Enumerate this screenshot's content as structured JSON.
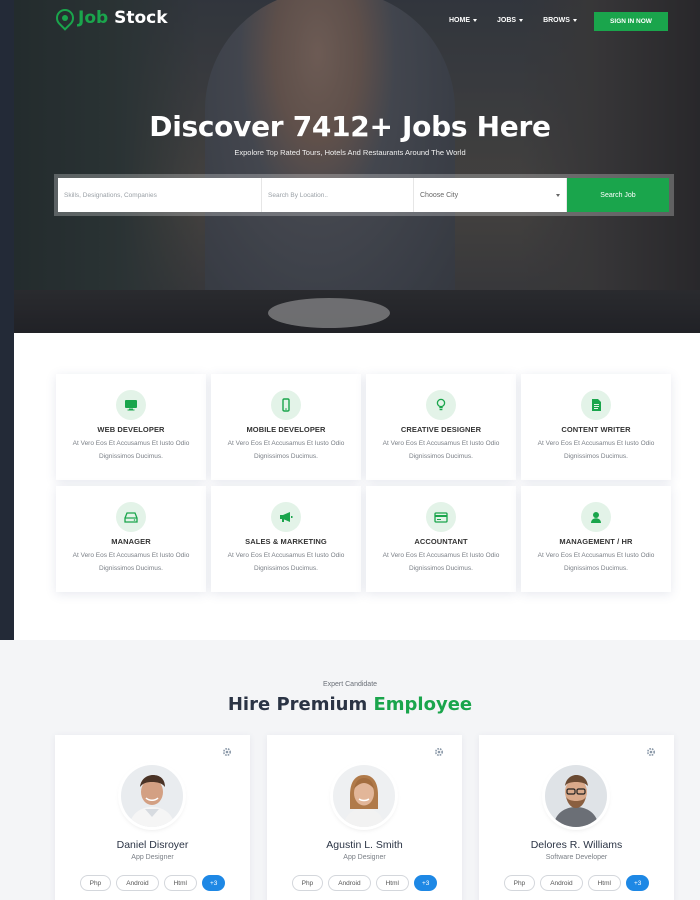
{
  "brand": {
    "part1": "Job",
    "part2": "Stock",
    "accent_color": "#1aa54c"
  },
  "nav": {
    "items": [
      {
        "label": "HOME"
      },
      {
        "label": "JOBS"
      },
      {
        "label": "BROWS"
      }
    ],
    "signin_label": "SIGN IN NOW"
  },
  "hero": {
    "title": "Discover 7412+ Jobs Here",
    "subtitle": "Expolore Top Rated Tours, Hotels And Restaurants Around The World"
  },
  "search": {
    "keywords_placeholder": "Skills, Designations, Companies",
    "location_placeholder": "Search By Location..",
    "city_selected": "Choose City",
    "button_label": "Search Job"
  },
  "categories": [
    {
      "title": "WEB DEVELOPER",
      "icon": "monitor-icon",
      "desc1": "At Vero Eos Et Accusamus Et Iusto Odio",
      "desc2": "Dignissimos Ducimus."
    },
    {
      "title": "MOBILE DEVELOPER",
      "icon": "mobile-icon",
      "desc1": "At Vero Eos Et Accusamus Et Iusto Odio",
      "desc2": "Dignissimos Ducimus."
    },
    {
      "title": "CREATIVE DESIGNER",
      "icon": "lightbulb-icon",
      "desc1": "At Vero Eos Et Accusamus Et Iusto Odio",
      "desc2": "Dignissimos Ducimus."
    },
    {
      "title": "CONTENT WRITER",
      "icon": "document-icon",
      "desc1": "At Vero Eos Et Accusamus Et Iusto Odio",
      "desc2": "Dignissimos Ducimus."
    },
    {
      "title": "MANAGER",
      "icon": "drive-icon",
      "desc1": "At Vero Eos Et Accusamus Et Iusto Odio",
      "desc2": "Dignissimos Ducimus."
    },
    {
      "title": "SALES & MARKETING",
      "icon": "megaphone-icon",
      "desc1": "At Vero Eos Et Accusamus Et Iusto Odio",
      "desc2": "Dignissimos Ducimus."
    },
    {
      "title": "ACCOUNTANT",
      "icon": "credit-card-icon",
      "desc1": "At Vero Eos Et Accusamus Et Iusto Odio",
      "desc2": "Dignissimos Ducimus."
    },
    {
      "title": "MANAGEMENT / HR",
      "icon": "user-icon",
      "desc1": "At Vero Eos Et Accusamus Et Iusto Odio",
      "desc2": "Dignissimos Ducimus."
    }
  ],
  "hire": {
    "eyebrow": "Expert Candidate",
    "title_part1": "Hire Premium",
    "title_part2": "Employee"
  },
  "employees": [
    {
      "name": "Daniel Disroyer",
      "role": "App Designer",
      "skills": [
        "Php",
        "Android",
        "Html"
      ],
      "more": "+3"
    },
    {
      "name": "Agustin L. Smith",
      "role": "App Designer",
      "skills": [
        "Php",
        "Android",
        "Html"
      ],
      "more": "+3"
    },
    {
      "name": "Delores R. Williams",
      "role": "Software Developer",
      "skills": [
        "Php",
        "Android",
        "Html"
      ],
      "more": "+3"
    }
  ]
}
